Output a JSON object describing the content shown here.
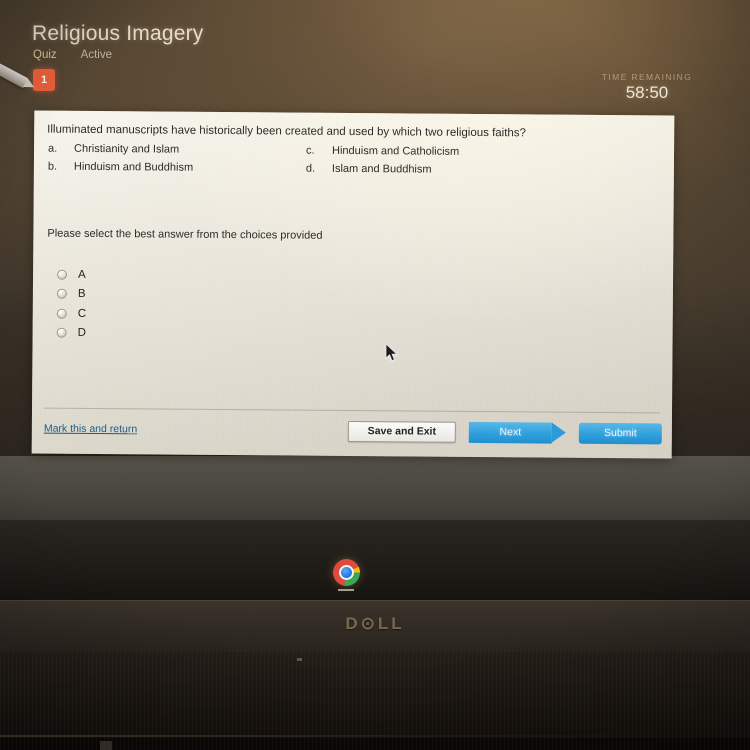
{
  "header": {
    "title": "Religious Imagery",
    "breadcrumbs": [
      {
        "label": "Quiz"
      },
      {
        "label": "Active"
      }
    ],
    "question_badge": "1",
    "timer_label": "TIME REMAINING",
    "timer_value": "58:50"
  },
  "question": {
    "prompt": "Illuminated manuscripts have historically been created and used by which two religious faiths?",
    "choices": [
      {
        "letter": "a.",
        "text": "Christianity and Islam"
      },
      {
        "letter": "b.",
        "text": "Hinduism and Buddhism"
      },
      {
        "letter": "c.",
        "text": "Hinduism and Catholicism"
      },
      {
        "letter": "d.",
        "text": "Islam and Buddhism"
      }
    ],
    "instruction": "Please select the best answer from the choices provided",
    "answers": [
      {
        "label": "A",
        "selected": false
      },
      {
        "label": "B",
        "selected": false
      },
      {
        "label": "C",
        "selected": false
      },
      {
        "label": "D",
        "selected": false
      }
    ]
  },
  "footer": {
    "mark_return_label": "Mark this and return",
    "save_exit_label": "Save and Exit",
    "next_label": "Next",
    "submit_label": "Submit"
  },
  "taskbar": {
    "chrome_icon": "chrome-icon"
  },
  "hardware": {
    "brand_logo": "D⊙LL"
  },
  "colors": {
    "badge_orange": "#e9603a",
    "button_blue": "#2f9fdc",
    "link_blue": "#1f5b86",
    "card_cream": "#efebdf",
    "screen_brown": "#5d4b35"
  }
}
